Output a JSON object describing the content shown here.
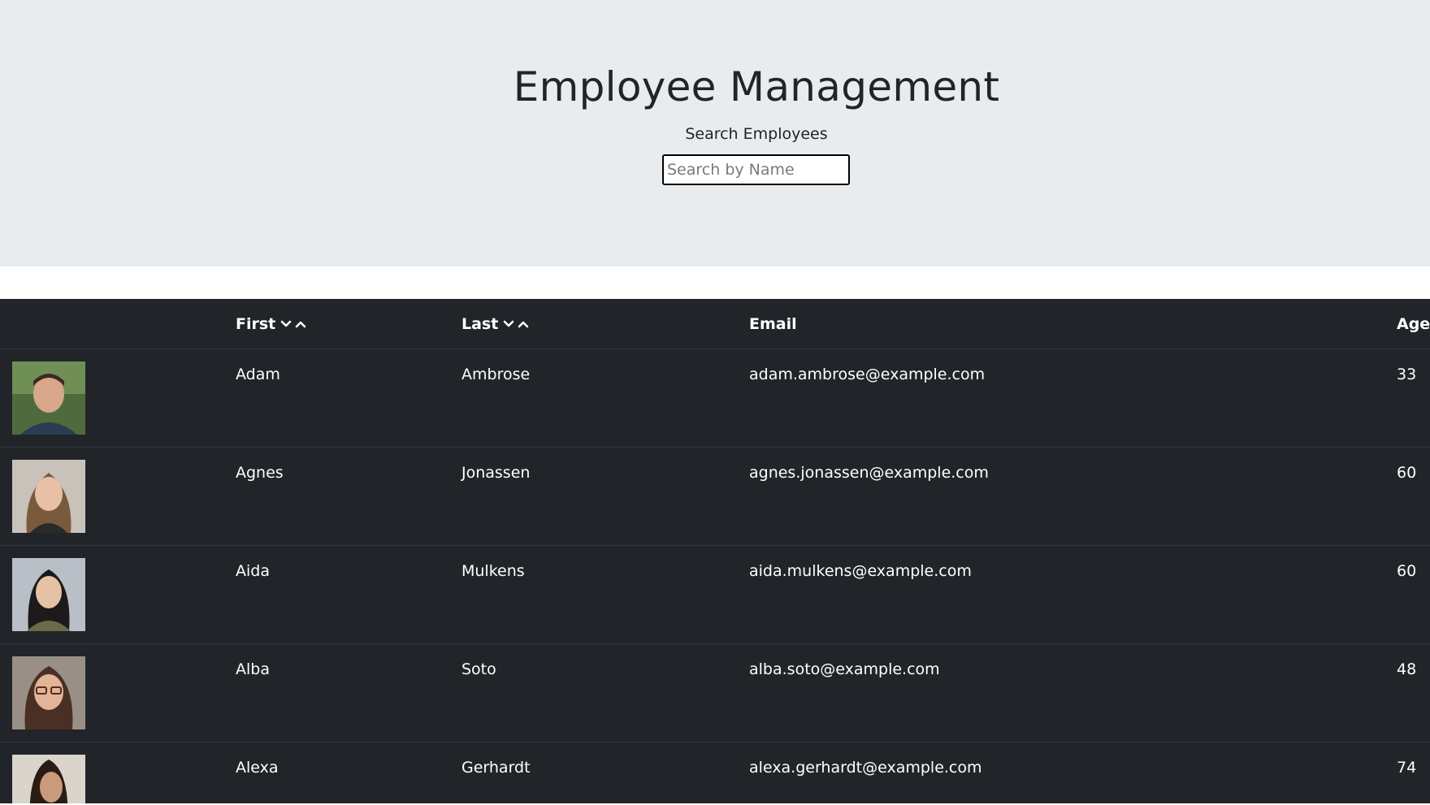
{
  "header": {
    "title": "Employee Management",
    "search_label": "Search Employees",
    "search_placeholder": "Search by Name",
    "search_value": ""
  },
  "table": {
    "columns": {
      "image": "",
      "first": "First",
      "last": "Last",
      "email": "Email",
      "age": "Age"
    },
    "sortable_icons": [
      "chevron-down-icon",
      "chevron-up-icon"
    ],
    "rows": [
      {
        "first": "Adam",
        "last": "Ambrose",
        "email": "adam.ambrose@example.com",
        "age": "33"
      },
      {
        "first": "Agnes",
        "last": "Jonassen",
        "email": "agnes.jonassen@example.com",
        "age": "60"
      },
      {
        "first": "Aida",
        "last": "Mulkens",
        "email": "aida.mulkens@example.com",
        "age": "60"
      },
      {
        "first": "Alba",
        "last": "Soto",
        "email": "alba.soto@example.com",
        "age": "48"
      },
      {
        "first": "Alexa",
        "last": "Gerhardt",
        "email": "alexa.gerhardt@example.com",
        "age": "74"
      }
    ]
  },
  "colors": {
    "jumbotron_bg": "#e9ecef",
    "table_bg": "#212529",
    "row_border": "#32383e",
    "text_dark": "#212529",
    "text_light": "#ffffff"
  }
}
